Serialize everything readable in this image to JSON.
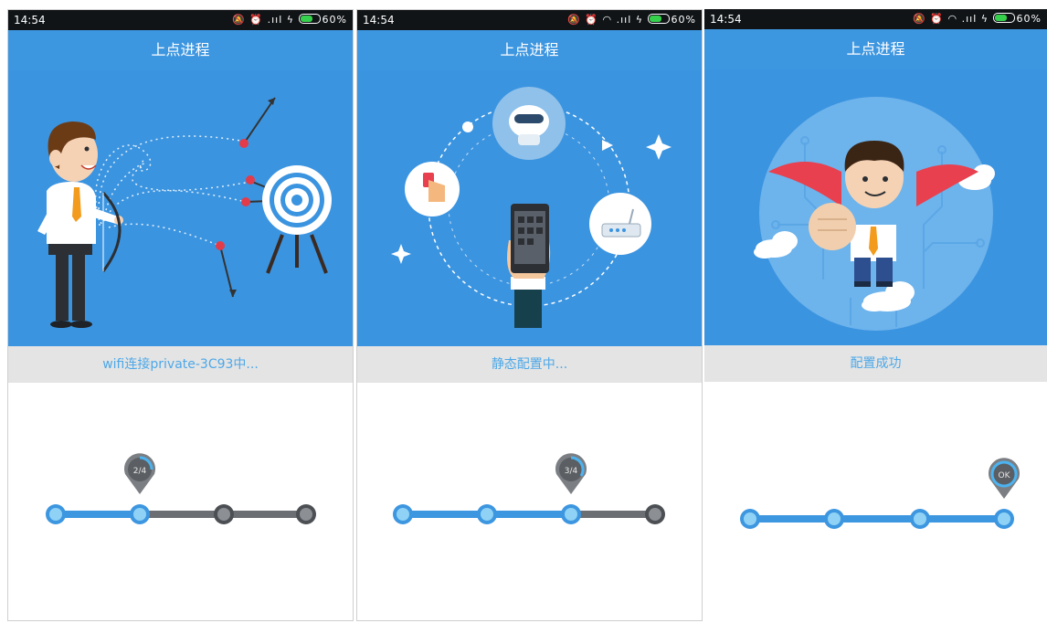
{
  "screens": [
    {
      "status_time": "14:54",
      "battery": "60%",
      "title": "上点进程",
      "status_text": "wifi连接private-3C93中...",
      "step_badge": "2/4",
      "accent": "#3b94e0"
    },
    {
      "status_time": "14:54",
      "battery": "60%",
      "title": "上点进程",
      "status_text": "静态配置中...",
      "step_badge": "3/4",
      "accent": "#3b94e0"
    },
    {
      "status_time": "14:54",
      "battery": "60%",
      "title": "上点进程",
      "status_text": "配置成功",
      "step_badge": "OK",
      "accent": "#3b94e0"
    }
  ]
}
